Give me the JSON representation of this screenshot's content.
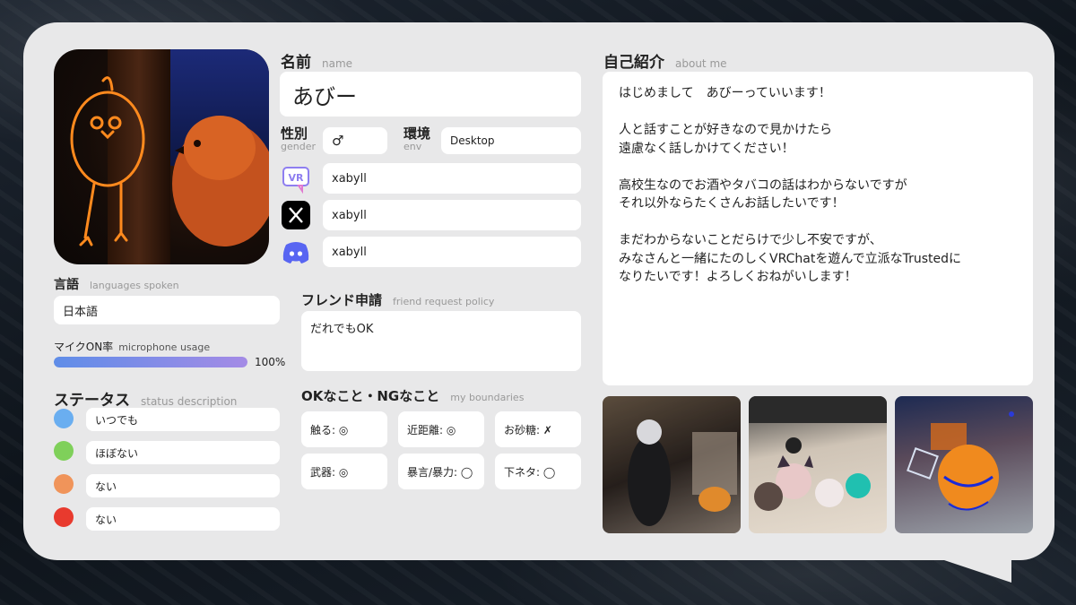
{
  "profile": {
    "name_label": "名前",
    "name_sub": "name",
    "name_value": "あびー",
    "gender_label": "性別",
    "gender_sub": "gender",
    "gender_value": "♂",
    "env_label": "環境",
    "env_sub": "env",
    "env_value": "Desktop",
    "accounts": [
      {
        "icon": "vrchat-icon",
        "value": "xabyll"
      },
      {
        "icon": "x-twitter-icon",
        "value": "xabyll"
      },
      {
        "icon": "discord-icon",
        "value": "xabyll"
      }
    ]
  },
  "languages": {
    "label": "言語",
    "sub": "languages spoken",
    "value": "日本語"
  },
  "mic": {
    "label": "マイクON率",
    "sub": "microphone usage",
    "percent_text": "100%",
    "fraction": 1.0
  },
  "status": {
    "label": "ステータス",
    "sub": "status description",
    "items": [
      {
        "color": "#6aaef0",
        "text": "いつでも"
      },
      {
        "color": "#7fd05a",
        "text": "ほぼない"
      },
      {
        "color": "#f0945a",
        "text": "ない"
      },
      {
        "color": "#e83a2e",
        "text": "ない"
      }
    ]
  },
  "friend": {
    "label": "フレンド申請",
    "sub": "friend request policy",
    "value": "だれでもOK"
  },
  "boundaries": {
    "label": "OKなこと・NGなこと",
    "sub": "my boundaries",
    "items": [
      "触る: ◎",
      "近距離: ◎",
      "お砂糖: ✗",
      "武器: ◎",
      "暴言/暴力: ◯",
      "下ネタ: ◯"
    ]
  },
  "about": {
    "label": "自己紹介",
    "sub": "about me",
    "text": "はじめまして　あびーっていいます！\n\n人と話すことが好きなので見かけたら\n遠慮なく話しかけてください！\n\n高校生なのでお酒やタバコの話はわからないですが\nそれ以外ならたくさんお話したいです！\n\nまだわからないことだらけで少し不安ですが、\nみなさんと一緒にたのしくVRChatを遊んで立派なTrustedに\nなりたいです！よろしくおねがいします！"
  },
  "colors": {
    "card": "#e8e8e9",
    "box": "#ffffff",
    "bar_start": "#5f8de8",
    "bar_end": "#a48be6"
  }
}
